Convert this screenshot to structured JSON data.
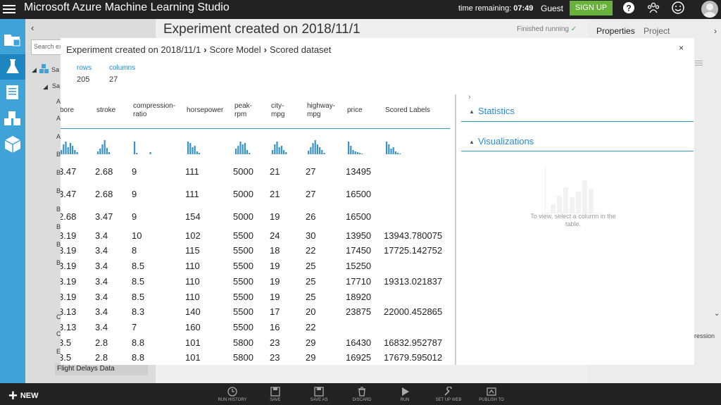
{
  "app": {
    "title": "Microsoft Azure Machine Learning Studio",
    "time_label": "time remaining:",
    "time_value": "07:49",
    "guest": "Guest",
    "signup": "SIGN UP"
  },
  "palette": {
    "search_placeholder": "Search ex",
    "letters": [
      "Sa",
      "Sa",
      "A",
      "A",
      "A",
      "B",
      "B",
      "B",
      "B",
      "B",
      "B",
      "B",
      "C",
      "C",
      "E"
    ],
    "flight_item": "Flight Delays Data"
  },
  "canvas": {
    "title": "Experiment created on 2018/11/1",
    "status": "Finished running"
  },
  "right_panel": {
    "tabs": [
      "Properties",
      "Project"
    ],
    "truncated": "ression"
  },
  "modal": {
    "breadcrumb": [
      "Experiment created on 2018/11/1",
      "Score Model",
      "Scored dataset"
    ],
    "close": "×",
    "summary": [
      {
        "label": "rows",
        "value": "205"
      },
      {
        "label": "columns",
        "value": "27"
      }
    ],
    "columns": [
      {
        "line1": "bore",
        "line2": ""
      },
      {
        "line1": "stroke",
        "line2": ""
      },
      {
        "line1": "compression-",
        "line2": "ratio"
      },
      {
        "line1": "horsepower",
        "line2": ""
      },
      {
        "line1": "peak-",
        "line2": "rpm"
      },
      {
        "line1": "city-",
        "line2": "mpg"
      },
      {
        "line1": "highway-",
        "line2": "mpg"
      },
      {
        "line1": "price",
        "line2": ""
      },
      {
        "line1": "Scored Labels",
        "line2": ""
      }
    ],
    "rows": [
      [
        "3.47",
        "2.68",
        "9",
        "111",
        "5000",
        "21",
        "27",
        "13495",
        ""
      ],
      [
        "3.47",
        "2.68",
        "9",
        "111",
        "5000",
        "21",
        "27",
        "16500",
        ""
      ],
      [
        "2.68",
        "3.47",
        "9",
        "154",
        "5000",
        "19",
        "26",
        "16500",
        ""
      ],
      [
        "3.19",
        "3.4",
        "10",
        "102",
        "5500",
        "24",
        "30",
        "13950",
        "13943.780075"
      ],
      [
        "3.19",
        "3.4",
        "8",
        "115",
        "5500",
        "18",
        "22",
        "17450",
        "17725.142752"
      ],
      [
        "3.19",
        "3.4",
        "8.5",
        "110",
        "5500",
        "19",
        "25",
        "15250",
        ""
      ],
      [
        "3.19",
        "3.4",
        "8.5",
        "110",
        "5500",
        "19",
        "25",
        "17710",
        "19313.021837"
      ],
      [
        "3.19",
        "3.4",
        "8.5",
        "110",
        "5500",
        "19",
        "25",
        "18920",
        ""
      ],
      [
        "3.13",
        "3.4",
        "8.3",
        "140",
        "5500",
        "17",
        "20",
        "23875",
        "22000.452865"
      ],
      [
        "3.13",
        "3.4",
        "7",
        "160",
        "5500",
        "16",
        "22",
        "",
        ""
      ],
      [
        "3.5",
        "2.8",
        "8.8",
        "101",
        "5800",
        "23",
        "29",
        "16430",
        "16832.952787"
      ],
      [
        "3.5",
        "2.8",
        "8.8",
        "101",
        "5800",
        "23",
        "29",
        "16925",
        "17679.595012"
      ]
    ],
    "statistics": "Statistics",
    "visualizations": "Visualizations",
    "viz_note": "To view, select a column in the table."
  },
  "toolbar": {
    "new": "NEW",
    "actions": [
      "RUN HISTORY",
      "SAVE",
      "SAVE AS",
      "DISCARD",
      "RUN",
      "SET UP WEB",
      "PUBLISH TO"
    ]
  },
  "colors": {
    "accent": "#3a93c7",
    "link": "#2a8ad4",
    "nav": "#3fa3d7",
    "signup": "#68b13a"
  }
}
